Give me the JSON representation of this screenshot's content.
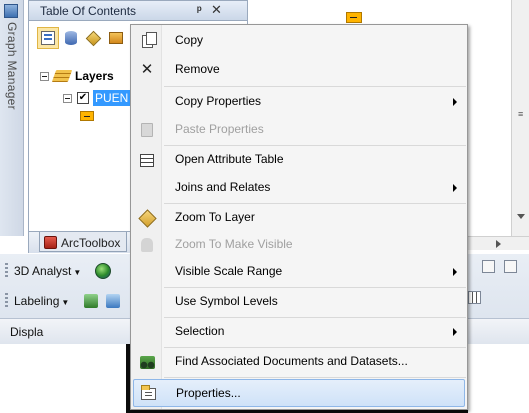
{
  "graph_manager": {
    "label": "Graph Manager"
  },
  "toc": {
    "title": "Table Of Contents",
    "pin": "ᵖ",
    "close": "✕",
    "tree": {
      "layers_label": "Layers",
      "layer_name": "PUEN"
    },
    "bottom_tab": "ArcToolbox"
  },
  "toolbars": {
    "analyst_3d": "3D Analyst",
    "labeling": "Labeling",
    "status": "Displa"
  },
  "context_menu": {
    "items": [
      {
        "label": "Copy",
        "icon": "copy-icon",
        "enabled": true,
        "submenu": false
      },
      {
        "label": "Remove",
        "icon": "remove-icon",
        "enabled": true,
        "submenu": false
      },
      {
        "label": "Copy Properties",
        "icon": "",
        "enabled": true,
        "submenu": true
      },
      {
        "label": "Paste Properties",
        "icon": "paste-icon",
        "enabled": false,
        "submenu": false
      },
      {
        "label": "Open Attribute Table",
        "icon": "table-icon",
        "enabled": true,
        "submenu": false
      },
      {
        "label": "Joins and Relates",
        "icon": "",
        "enabled": true,
        "submenu": true
      },
      {
        "label": "Zoom To Layer",
        "icon": "zoom-to-layer-icon",
        "enabled": true,
        "submenu": false
      },
      {
        "label": "Zoom To Make Visible",
        "icon": "zoom-visible-icon",
        "enabled": false,
        "submenu": false
      },
      {
        "label": "Visible Scale Range",
        "icon": "",
        "enabled": true,
        "submenu": true
      },
      {
        "label": "Use Symbol Levels",
        "icon": "",
        "enabled": true,
        "submenu": false
      },
      {
        "label": "Selection",
        "icon": "",
        "enabled": true,
        "submenu": true
      },
      {
        "label": "Find Associated Documents and Datasets...",
        "icon": "binoculars-icon",
        "enabled": true,
        "submenu": false
      },
      {
        "label": "Properties...",
        "icon": "properties-icon",
        "enabled": true,
        "submenu": false,
        "highlighted": true
      }
    ]
  }
}
